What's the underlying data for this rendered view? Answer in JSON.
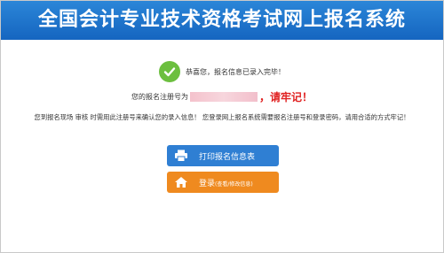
{
  "header": {
    "title": "全国会计专业技术资格考试网上报名系统"
  },
  "success": {
    "message": "恭喜您，报名信息已录入完毕！"
  },
  "registration": {
    "label": "您的报名注册号为",
    "remember": "，请牢记！"
  },
  "note": {
    "text": "您到报名现场 审核 时需用此注册号来确认您的录入信息！ 您登录网上报名系统需要报名注册号和登录密码，请用合适的方式牢记！"
  },
  "buttons": {
    "print_label": "打印报名信息表",
    "login_label": "登录",
    "login_sub": "(查看/修改信息)"
  },
  "icons": {
    "success": "check-icon",
    "print": "printer-icon",
    "login": "home-icon"
  },
  "colors": {
    "header": "#1e73c9",
    "success": "#6cbf3f",
    "remember": "#e02020",
    "print": "#2f7fd3",
    "login": "#ef8a1f"
  }
}
